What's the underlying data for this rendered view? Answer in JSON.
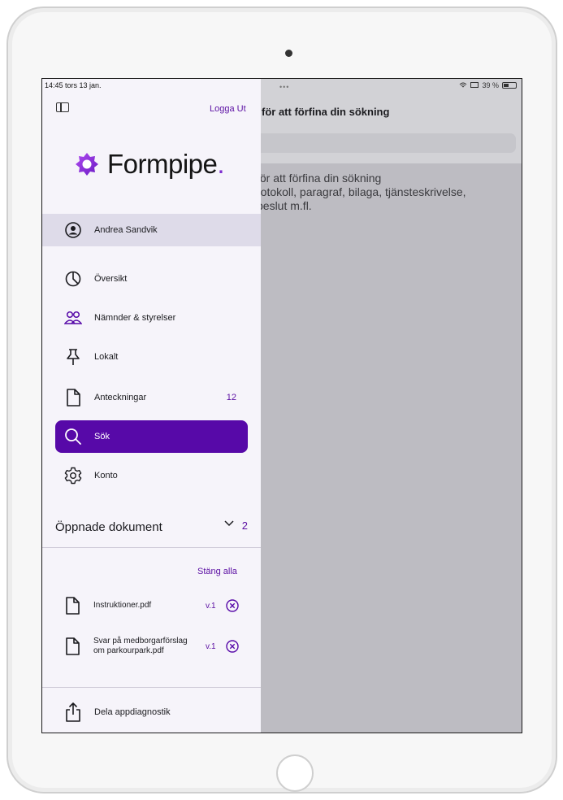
{
  "status_bar": {
    "time_date": "14:45  tors 13 jan.",
    "dots": "•••",
    "battery_text": "39 %"
  },
  "sidebar": {
    "logout_label": "Logga Ut",
    "logo_text": "Formpipe",
    "logo_dot": ".",
    "user_name": "Andrea Sandvik",
    "nav": [
      {
        "label": "Översikt",
        "icon": "pie-chart-icon"
      },
      {
        "label": "Nämnder & styrelser",
        "icon": "people-icon"
      },
      {
        "label": "Lokalt",
        "icon": "pin-icon"
      },
      {
        "label": "Anteckningar",
        "icon": "document-icon",
        "badge": "12"
      },
      {
        "label": "Sök",
        "icon": "search-icon",
        "active": true
      },
      {
        "label": "Konto",
        "icon": "gear-icon"
      }
    ],
    "open_docs": {
      "title": "Öppnade dokument",
      "count": "2",
      "close_all": "Stäng alla",
      "items": [
        {
          "name": "Instruktioner.pdf",
          "version": "v.1"
        },
        {
          "name": "Svar på medborgarförslag om parkourpark.pdf",
          "version": "v.1"
        }
      ]
    },
    "share_label": "Dela appdiagnostik"
  },
  "content": {
    "title": "för att förfina din sökning",
    "hint_lines": [
      "för att förfina din sökning",
      "rotokoll, paragraf, bilaga, tjänsteskrivelse,",
      "beslut m.fl."
    ]
  },
  "colors": {
    "accent": "#5709a8",
    "accent_text": "#5b0fa3",
    "sidebar_bg": "#f6f4fa",
    "selected_row": "#dedbe9"
  }
}
